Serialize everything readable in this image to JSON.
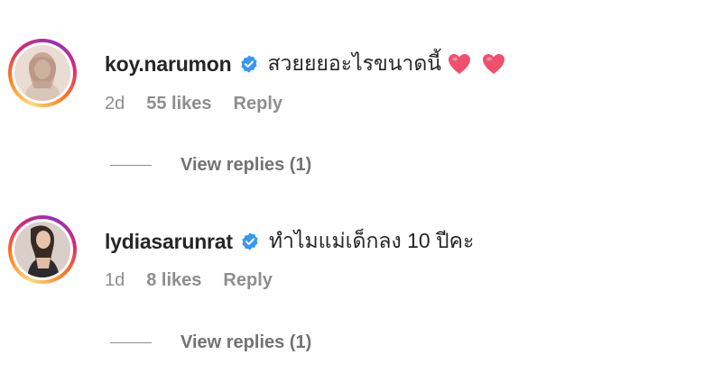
{
  "comments": [
    {
      "username": "koy.narumon",
      "text": "สวยยยอะไรขนาดนี้",
      "emoji": [
        "heart-emoji",
        "heart-emoji"
      ],
      "age": "2d",
      "likes": "55 likes",
      "reply_label": "Reply",
      "view_replies": "View replies (1)"
    },
    {
      "username": "lydiasarunrat",
      "text": "ทำไมแม่เด็กลง 10 ปีคะ",
      "age": "1d",
      "likes": "8 likes",
      "reply_label": "Reply",
      "view_replies": "View replies (1)"
    }
  ],
  "colors": {
    "verified": "#3897f0",
    "heart": "#f0506e",
    "meta_text": "#8e8e8e",
    "primary_text": "#262626"
  }
}
